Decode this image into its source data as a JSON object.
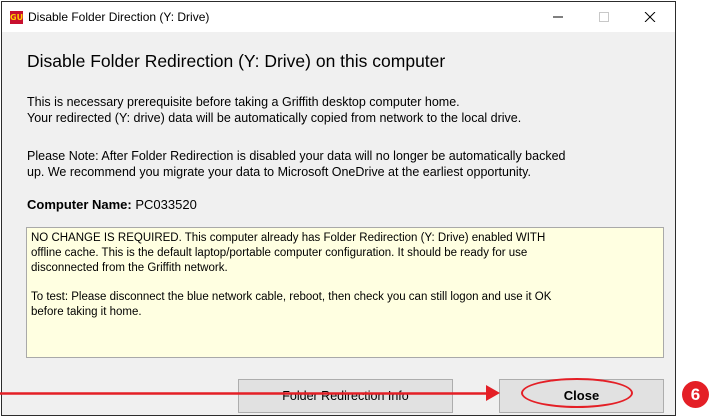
{
  "window": {
    "title": "Disable Folder Direction (Y: Drive)",
    "controls": {
      "minimize": "–",
      "maximize": "□",
      "close": "✕"
    }
  },
  "main": {
    "heading": "Disable Folder Redirection (Y: Drive) on this computer",
    "intro_lines": [
      "This is necessary prerequisite before taking a Griffith desktop computer home.",
      "Your redirected (Y: drive) data will be automatically copied from network to the local drive."
    ],
    "note_lines": [
      "Please Note: After Folder Redirection is disabled your data will no longer be automatically backed",
      "up. We recommend you migrate your data to Microsoft OneDrive at the earliest opportunity."
    ],
    "computer_name_label": "Computer Name:",
    "computer_name_value": "PC033520"
  },
  "status": {
    "lines1": [
      "NO CHANGE IS REQUIRED. This computer already has Folder Redirection (Y: Drive) enabled WITH",
      "offline cache. This is the default laptop/portable computer configuration. It should be ready for use",
      "disconnected from the Griffith network."
    ],
    "lines2": [
      "To test: Please disconnect the blue network cable, reboot, then check you can still logon and use it OK",
      "before taking it home."
    ]
  },
  "buttons": {
    "info": "Folder Redirection Info",
    "close": "Close"
  },
  "annotation": {
    "step_number": "6",
    "color": "#e41f26"
  },
  "icons": {
    "app": "griffith-app-icon",
    "minimize": "minimize-icon",
    "maximize": "maximize-icon",
    "close": "close-icon"
  }
}
